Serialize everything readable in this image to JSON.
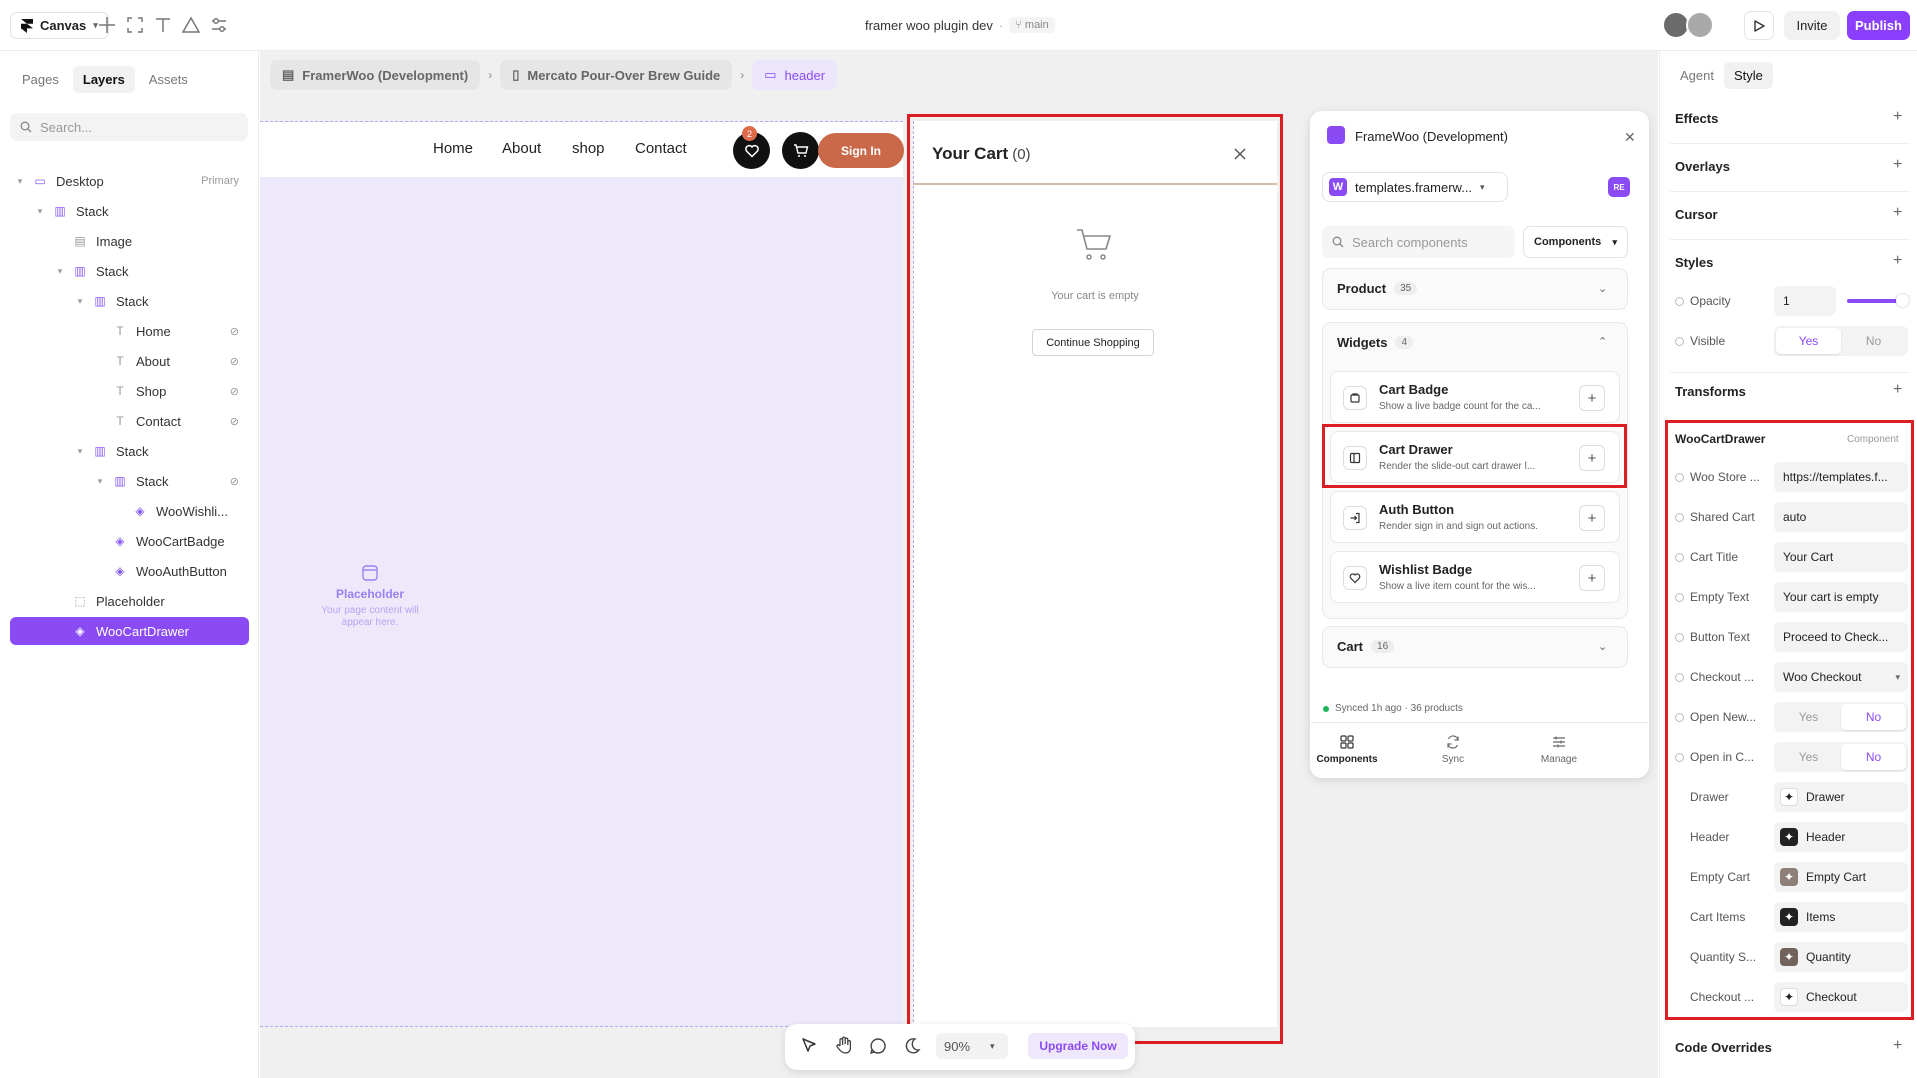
{
  "topbar": {
    "canvas_label": "Canvas",
    "project_title": "framer woo plugin dev",
    "branch": "main",
    "invite_label": "Invite",
    "publish_label": "Publish"
  },
  "left_panel": {
    "tabs": [
      "Pages",
      "Layers",
      "Assets"
    ],
    "search_placeholder": "Search...",
    "layers": [
      {
        "label": "Desktop",
        "extra": "Primary"
      },
      {
        "label": "Stack"
      },
      {
        "label": "Image"
      },
      {
        "label": "Stack"
      },
      {
        "label": "Stack"
      },
      {
        "label": "Home"
      },
      {
        "label": "About"
      },
      {
        "label": "Shop"
      },
      {
        "label": "Contact"
      },
      {
        "label": "Stack"
      },
      {
        "label": "Stack"
      },
      {
        "label": "WooWishli..."
      },
      {
        "label": "WooCartBadge"
      },
      {
        "label": "WooAuthButton"
      },
      {
        "label": "Placeholder"
      },
      {
        "label": "WooCartDrawer"
      }
    ]
  },
  "breadcrumbs": [
    "FramerWoo (Development)",
    "Mercato Pour-Over Brew Guide",
    "header"
  ],
  "site": {
    "nav": [
      "Home",
      "About",
      "shop",
      "Contact"
    ],
    "wishlist_count": "2",
    "signin_label": "Sign In",
    "placeholder_title": "Placeholder",
    "placeholder_sub": "Your page content will appear here."
  },
  "drawer": {
    "title": "Your Cart",
    "count": "(0)",
    "empty_text": "Your cart is empty",
    "continue_label": "Continue Shopping"
  },
  "bottom_toolbar": {
    "zoom": "90%",
    "upgrade_label": "Upgrade Now"
  },
  "plugin": {
    "title": "FrameWoo (Development)",
    "site": "templates.framerw...",
    "user_initials": "RE",
    "search_placeholder": "Search components",
    "filter_label": "Components",
    "sections": [
      {
        "name": "Product",
        "count": "35"
      },
      {
        "name": "Widgets",
        "count": "4"
      },
      {
        "name": "Cart",
        "count": "16"
      }
    ],
    "widgets": [
      {
        "title": "Cart Badge",
        "desc": "Show a live badge count for the ca..."
      },
      {
        "title": "Cart Drawer",
        "desc": "Render the slide-out cart drawer l..."
      },
      {
        "title": "Auth Button",
        "desc": "Render sign in and sign out actions."
      },
      {
        "title": "Wishlist Badge",
        "desc": "Show a live item count for the wis..."
      }
    ],
    "synced": "Synced 1h ago · 36 products",
    "tabs": [
      "Components",
      "Sync",
      "Manage"
    ]
  },
  "right_panel": {
    "tabs": [
      "Agent",
      "Style"
    ],
    "sections": [
      "Effects",
      "Overlays",
      "Cursor",
      "Styles",
      "Transforms",
      "Code Overrides"
    ],
    "opacity_label": "Opacity",
    "opacity_value": "1",
    "visible_label": "Visible",
    "yes": "Yes",
    "no": "No",
    "component_name": "WooCartDrawer",
    "component_tag": "Component",
    "props": [
      {
        "label": "Woo Store ...",
        "value": "https://templates.f..."
      },
      {
        "label": "Shared Cart",
        "value": "auto"
      },
      {
        "label": "Cart Title",
        "value": "Your Cart"
      },
      {
        "label": "Empty Text",
        "value": "Your cart is empty"
      },
      {
        "label": "Button Text",
        "value": "Proceed to Check..."
      },
      {
        "label": "Checkout ...",
        "value": "Woo Checkout"
      },
      {
        "label": "Open New...",
        "value": "No"
      },
      {
        "label": "Open in C...",
        "value": "No"
      }
    ],
    "slots": [
      {
        "label": "Drawer",
        "value": "Drawer"
      },
      {
        "label": "Header",
        "value": "Header"
      },
      {
        "label": "Empty Cart",
        "value": "Empty Cart"
      },
      {
        "label": "Cart Items",
        "value": "Items"
      },
      {
        "label": "Quantity S...",
        "value": "Quantity"
      },
      {
        "label": "Checkout ...",
        "value": "Checkout"
      }
    ]
  },
  "colors": {
    "accent": "#8a4bf5",
    "highlight": "#dd1c24",
    "signin": "#c9694a"
  }
}
